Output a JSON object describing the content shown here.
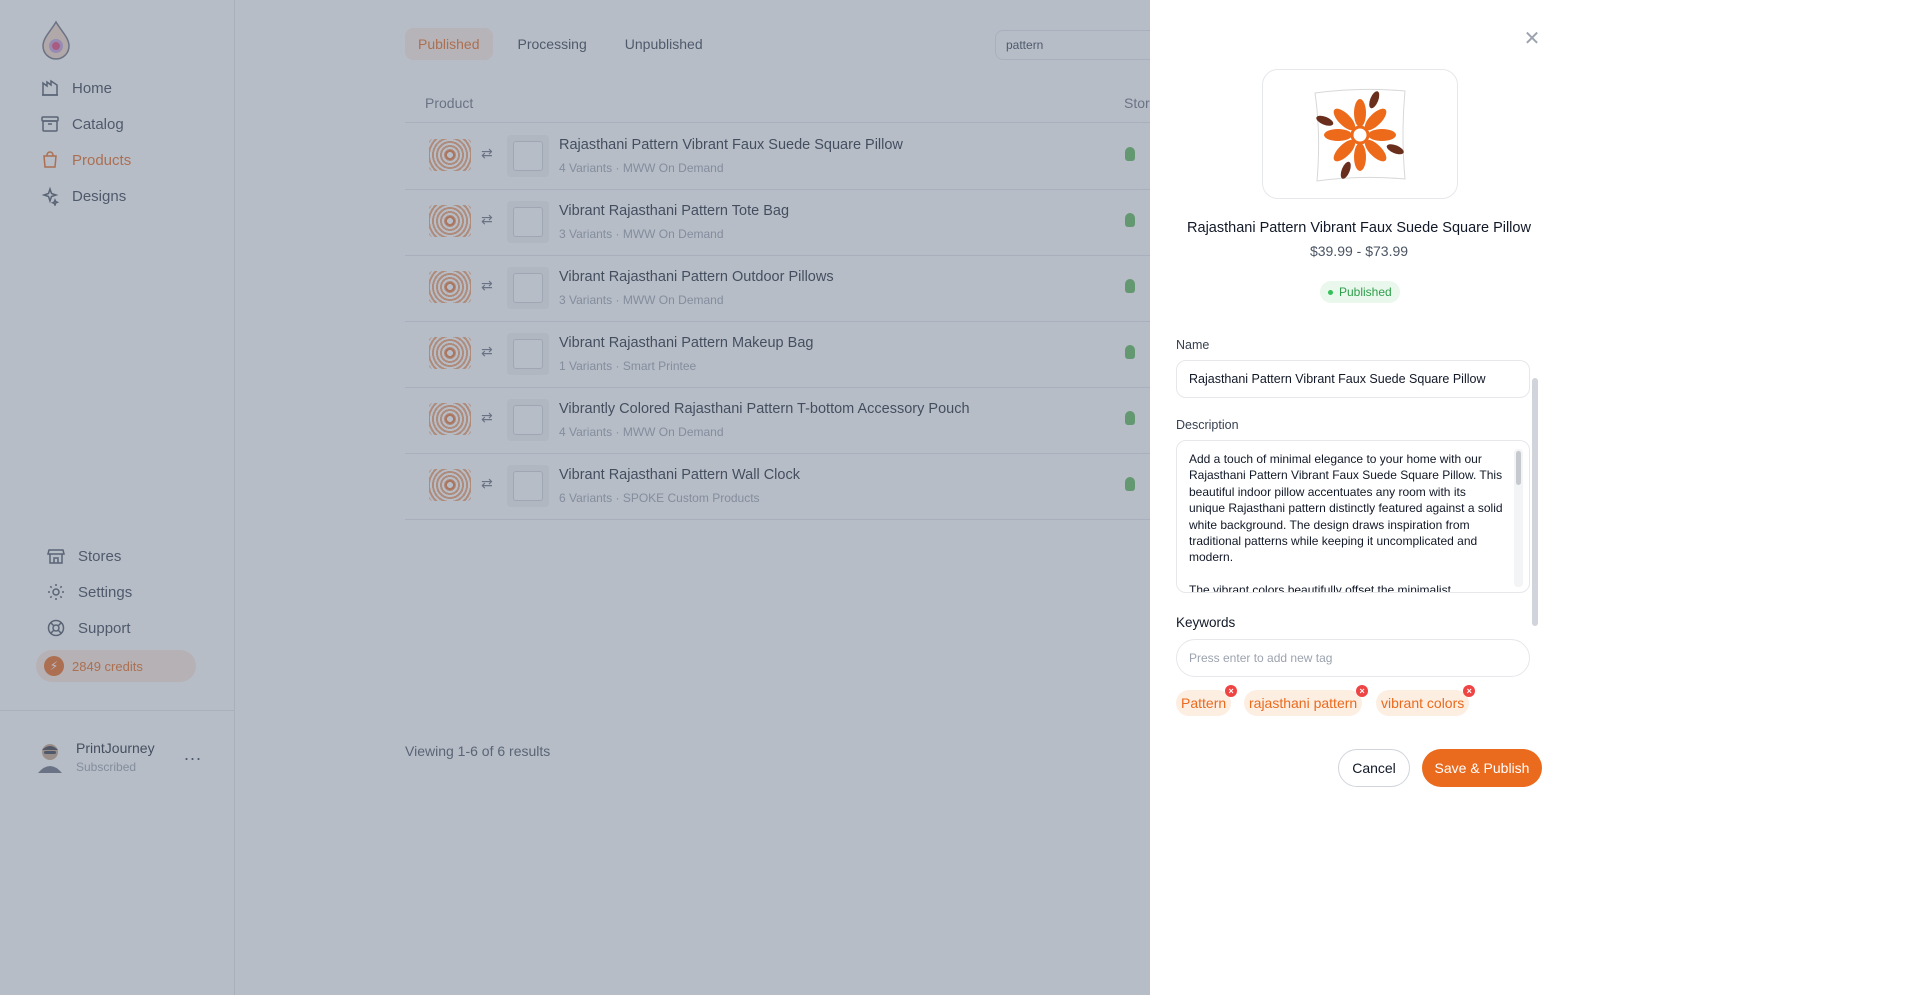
{
  "sidebar": {
    "nav": [
      {
        "label": "Home",
        "icon": "home-icon"
      },
      {
        "label": "Catalog",
        "icon": "catalog-icon"
      },
      {
        "label": "Products",
        "icon": "shopping-bag-icon",
        "active": true
      },
      {
        "label": "Designs",
        "icon": "sparkles-icon"
      }
    ],
    "bottom_nav": [
      {
        "label": "Stores",
        "icon": "store-icon"
      },
      {
        "label": "Settings",
        "icon": "gear-icon"
      },
      {
        "label": "Support",
        "icon": "lifebuoy-icon"
      }
    ],
    "credits": "2849 credits",
    "user": {
      "name": "PrintJourney",
      "status": "Subscribed",
      "more": "..."
    }
  },
  "main": {
    "tabs": [
      "Published",
      "Processing",
      "Unpublished"
    ],
    "active_tab": "Published",
    "search": {
      "value": "pattern"
    },
    "columns": {
      "product": "Product",
      "store": "Stor"
    },
    "rows": [
      {
        "title": "Rajasthani Pattern Vibrant Faux Suede Square Pillow",
        "variants": "4 Variants",
        "provider": "MWW On Demand"
      },
      {
        "title": "Vibrant Rajasthani Pattern Tote Bag",
        "variants": "3 Variants",
        "provider": "MWW On Demand"
      },
      {
        "title": "Vibrant Rajasthani Pattern Outdoor Pillows",
        "variants": "3 Variants",
        "provider": "MWW On Demand"
      },
      {
        "title": "Vibrant Rajasthani Pattern Makeup Bag",
        "variants": "1 Variants",
        "provider": "Smart Printee"
      },
      {
        "title": "Vibrantly Colored Rajasthani Pattern T-bottom Accessory Pouch",
        "variants": "4 Variants",
        "provider": "MWW On Demand"
      },
      {
        "title": "Vibrant Rajasthani Pattern Wall Clock",
        "variants": "6 Variants",
        "provider": "SPOKE Custom Products"
      }
    ],
    "separator": "·",
    "results": "Viewing 1-6 of 6 results"
  },
  "drawer": {
    "close_icon": "close-icon",
    "product_title": "Rajasthani Pattern Vibrant Faux Suede Square Pillow",
    "price_range": "$39.99 - $73.99",
    "status": "Published",
    "name_label": "Name",
    "name_value": "Rajasthani Pattern Vibrant Faux Suede Square Pillow",
    "description_label": "Description",
    "description_value": "Add a touch of minimal elegance to your home with our Rajasthani Pattern Vibrant Faux Suede Square Pillow. This beautiful indoor pillow accentuates any room with its unique Rajasthani pattern distinctly featured against a solid white background. The design draws inspiration from traditional patterns while keeping it uncomplicated and modern.\n\nThe vibrant colors beautifully offset the minimalist",
    "keywords_label": "Keywords",
    "keywords_placeholder": "Press enter to add new tag",
    "tags": [
      "Pattern",
      "rajasthani pattern",
      "vibrant colors"
    ],
    "cancel_label": "Cancel",
    "save_label": "Save & Publish"
  },
  "colors": {
    "accent": "#ea6a1e",
    "published_green": "#2f9e4b",
    "tag_remove": "#ef4444",
    "overlay": "#69768a"
  }
}
